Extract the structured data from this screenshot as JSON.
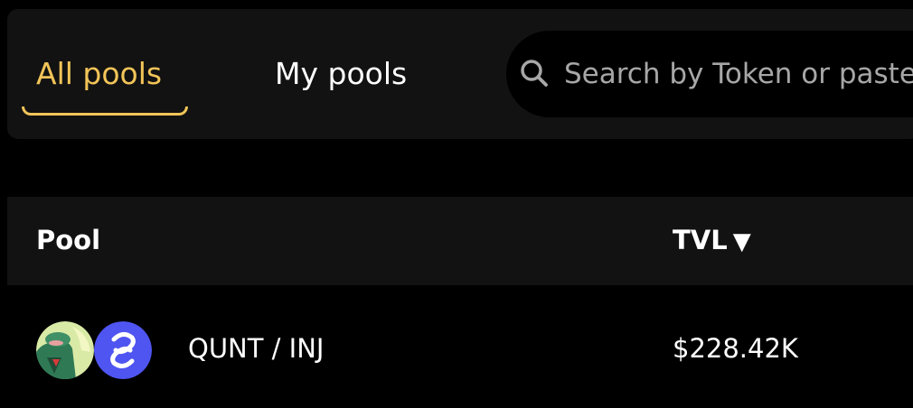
{
  "tabs": {
    "all_pools": "All pools",
    "my_pools": "My pools"
  },
  "search": {
    "placeholder": "Search by Token or paste address",
    "value": ""
  },
  "table": {
    "columns": {
      "pool": "Pool",
      "tvl": "TVL",
      "tvl_sort_icon": "triangle-down-icon"
    },
    "rows": [
      {
        "pair": "QUNT / INJ",
        "tvl": "$228.42K",
        "token_a_icon": "qunt-token-icon",
        "token_b_icon": "inj-token-icon"
      }
    ]
  },
  "colors": {
    "accent": "#f2c458",
    "panel": "#121212",
    "background": "#000000",
    "inj_blue": "#4f55f1"
  }
}
